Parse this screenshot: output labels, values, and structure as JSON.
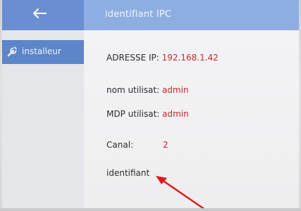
{
  "header": {
    "title": "identifiant IPC",
    "back_icon": "arrow-left-icon"
  },
  "sidebar": {
    "items": [
      {
        "label": "installeur",
        "icon": "wrench-icon",
        "selected": true
      }
    ]
  },
  "form": {
    "ip": {
      "label": "ADRESSE IP:",
      "value": "192.168.1.42"
    },
    "user": {
      "label": "nom utilisat:",
      "value": "admin"
    },
    "password": {
      "label": "MDP utilisat:",
      "value": "admin"
    },
    "canal": {
      "label": "Canal:",
      "value": "2"
    },
    "identifiant": {
      "label": "identifiant"
    }
  },
  "colors": {
    "header_left": "#6a8ed1",
    "header_right": "#8eaee2",
    "sidebar_selected": "#5d85c9",
    "value_text": "#c02a30",
    "annotation": "#e01818"
  }
}
